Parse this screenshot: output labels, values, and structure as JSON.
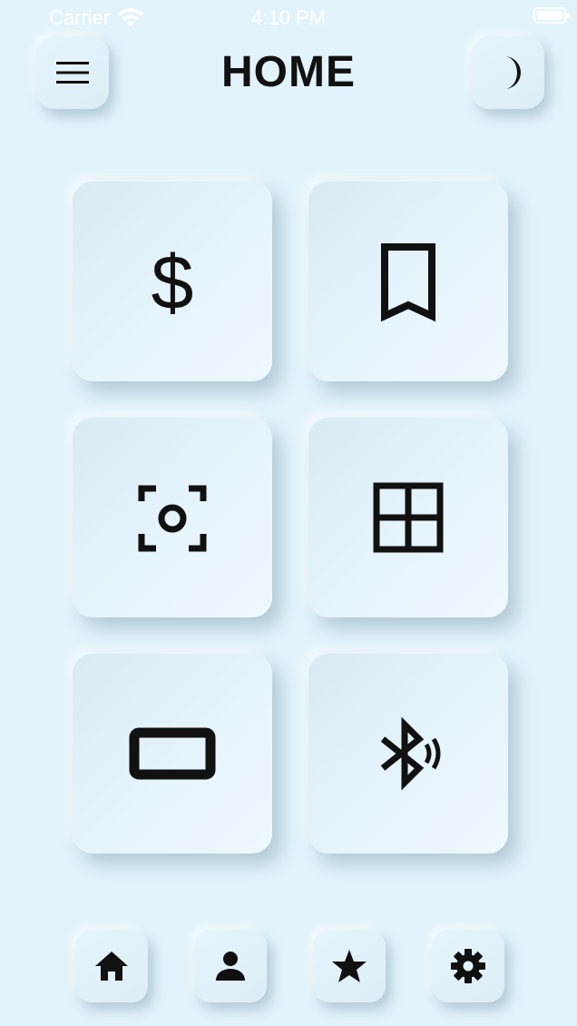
{
  "status_bar": {
    "carrier": "Carrier",
    "time": "4:10 PM",
    "wifi_icon": "wifi-icon",
    "battery_icon": "battery-icon"
  },
  "header": {
    "title": "HOME",
    "menu_icon": "hamburger-menu-icon",
    "theme_icon": "moon-icon"
  },
  "tiles": [
    {
      "icon": "dollar-icon"
    },
    {
      "icon": "bookmark-icon"
    },
    {
      "icon": "camera-focus-icon"
    },
    {
      "icon": "grid-icon"
    },
    {
      "icon": "tablet-landscape-icon"
    },
    {
      "icon": "bluetooth-audio-icon"
    }
  ],
  "bottom_nav": [
    {
      "icon": "home-icon"
    },
    {
      "icon": "person-icon"
    },
    {
      "icon": "star-icon"
    },
    {
      "icon": "settings-icon"
    }
  ],
  "colors": {
    "background": "#e2f3fb",
    "icon": "#111111",
    "status_text": "#ffffff"
  }
}
